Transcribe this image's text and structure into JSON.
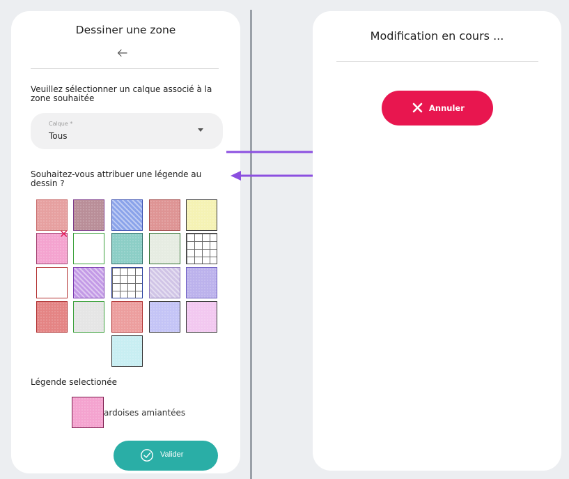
{
  "left": {
    "title": "Dessiner une zone",
    "layer_prompt": "Veuillez sélectionner un calque associé à la zone souhaitée",
    "layer_select": {
      "label": "Calque *",
      "value": "Tous"
    },
    "legend_prompt": "Souhaitez-vous attribuer une légende au dessin ?",
    "selected_label": "Légende selectionée",
    "selected_name": "ardoises amiantées",
    "validate_label": "Valider"
  },
  "right": {
    "title": "Modification en cours ...",
    "cancel_label": "Annuler"
  },
  "colors": {
    "accent_teal": "#2aaea6",
    "accent_red": "#e8164f",
    "arrow_purple": "#8b4fe0"
  },
  "swatches": [
    {
      "fill": "#e6a0a0",
      "border": "#c86a6a",
      "pattern": "dots"
    },
    {
      "fill": "#b98e98",
      "border": "#7d3a8a",
      "pattern": "dots"
    },
    {
      "fill": "#8aa3ea",
      "border": "#3a4fb0",
      "pattern": "diag"
    },
    {
      "fill": "#de9494",
      "border": "#a04848",
      "pattern": "dots"
    },
    {
      "fill": "#f5f2b4",
      "border": "#333333",
      "pattern": "dots"
    },
    {
      "fill": "#f4a3cf",
      "border": "#a0406f",
      "pattern": "dots"
    },
    {
      "fill": "#ffffff",
      "border": "#3aa03a",
      "pattern": "dots"
    },
    {
      "fill": "#8ccec6",
      "border": "#2f6f6a",
      "pattern": "dots"
    },
    {
      "fill": "#e6ece2",
      "border": "#2f6f2f",
      "pattern": "dots"
    },
    {
      "fill": "#ffffff",
      "border": "#444444",
      "pattern": "grid"
    },
    {
      "fill": "#ffffff",
      "border": "#b23030",
      "pattern": "dots"
    },
    {
      "fill": "#c39ae6",
      "border": "#7a3ab0",
      "pattern": "diag"
    },
    {
      "fill": "#ffffff",
      "border": "#2a3fa0",
      "pattern": "grid"
    },
    {
      "fill": "#d0c4e6",
      "border": "#8a78b8",
      "pattern": "diag"
    },
    {
      "fill": "#bcb2ec",
      "border": "#6a5ac0",
      "pattern": "dots"
    },
    {
      "fill": "#e48484",
      "border": "#b03030",
      "pattern": "dots"
    },
    {
      "fill": "#e5e5e5",
      "border": "#3aa03a",
      "pattern": "dots"
    },
    {
      "fill": "#ec9e9e",
      "border": "#b03030",
      "pattern": "dots"
    },
    {
      "fill": "#c4c4f6",
      "border": "#333333",
      "pattern": "dots"
    },
    {
      "fill": "#f2c8f0",
      "border": "#333333",
      "pattern": "dots"
    },
    {
      "fill": "#c8eef2",
      "border": "#333333",
      "pattern": "dots"
    }
  ]
}
